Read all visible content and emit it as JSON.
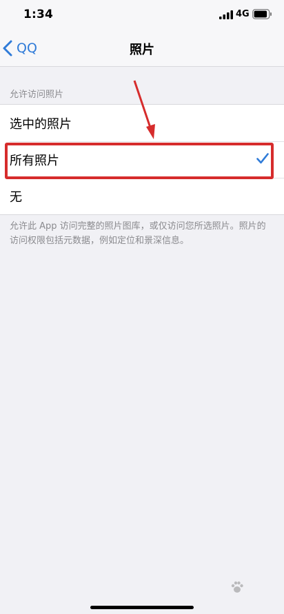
{
  "status_bar": {
    "time": "1:34",
    "network": "4G",
    "signal_icon": "signal-bars-icon",
    "battery_icon": "battery-icon"
  },
  "nav": {
    "back_label": "QQ",
    "back_icon": "chevron-left-icon",
    "title": "照片"
  },
  "section": {
    "header": "允许访问照片",
    "options": [
      {
        "label": "选中的照片",
        "selected": false
      },
      {
        "label": "所有照片",
        "selected": true
      },
      {
        "label": "无",
        "selected": false
      }
    ],
    "footer": "允许此 App 访问完整的照片图库，或仅访问您所选照片。照片的访问权限包括元数据，例如定位和景深信息。"
  },
  "colors": {
    "accent": "#2f7bd8",
    "annotation": "#d62c2c",
    "background": "#f1f1f5"
  }
}
